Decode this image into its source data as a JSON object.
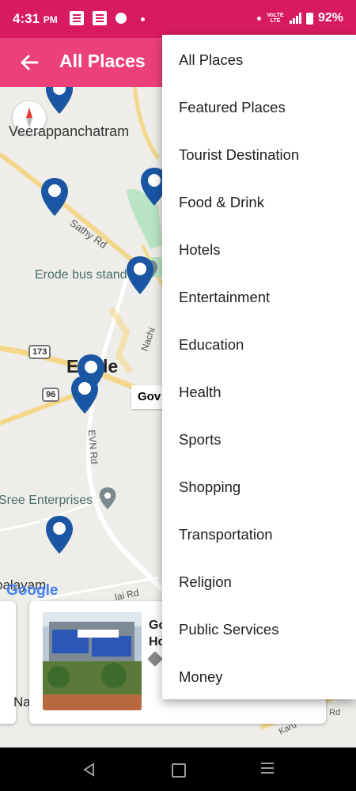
{
  "status_bar": {
    "time": "4:31",
    "ampm": "PM",
    "battery": "92%",
    "network": "VoLTE LTE"
  },
  "app_bar": {
    "back_icon": "arrow-left-icon",
    "title": "All Places"
  },
  "map": {
    "labels": {
      "veerappanchatram": "Veerappanchatram",
      "sathy_rd": "Sathy Rd",
      "erode_bus_stand": "Erode bus stand",
      "erode": "Erode",
      "nachi": "Nachi",
      "evn_rd": "EVN Rd",
      "sree_enterprises": "Sree Enterprises",
      "palayam": "palayam",
      "lai_rd": "lai Rd",
      "karur": "Karu",
      "rd_right": "Rd"
    },
    "shields": [
      "173",
      "96"
    ],
    "gov_chip": "Gov",
    "google": "Google",
    "pin_color": "#1a56a3"
  },
  "cards": {
    "left_text": "Na",
    "main_title_1": "Go",
    "main_title_2": "Ho"
  },
  "menu": {
    "items": [
      "All Places",
      "Featured Places",
      "Tourist Destination",
      "Food & Drink",
      "Hotels",
      "Entertainment",
      "Education",
      "Health",
      "Sports",
      "Shopping",
      "Transportation",
      "Religion",
      "Public Services",
      "Money"
    ]
  },
  "nav_bar": {
    "back": "nav-back-icon",
    "home": "nav-home-icon",
    "recent": "nav-recent-icon"
  },
  "colors": {
    "status_bar": "#d81b60",
    "app_bar": "#ec407a"
  }
}
